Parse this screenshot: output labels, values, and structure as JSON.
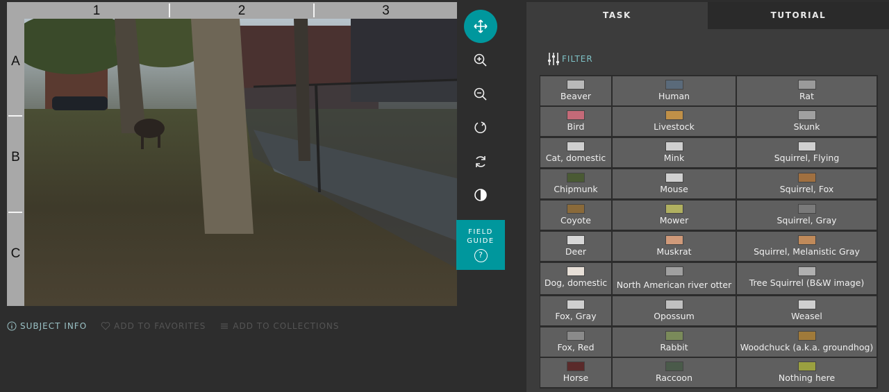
{
  "viewer": {
    "columns": [
      "1",
      "2",
      "3"
    ],
    "rows": [
      "A",
      "B",
      "C"
    ]
  },
  "tools": {
    "field_guide_line1": "FIELD",
    "field_guide_line2": "GUIDE",
    "field_guide_q": "?"
  },
  "meta": {
    "subject_info": "SUBJECT INFO",
    "add_to_favorites": "ADD TO FAVORITES",
    "add_to_collections": "ADD TO COLLECTIONS"
  },
  "panel": {
    "tab_task": "TASK",
    "tab_tutorial": "TUTORIAL",
    "filter": "FILTER",
    "columns": [
      [
        "Beaver",
        "Bird",
        "Cat, domestic",
        "Chipmunk",
        "Coyote",
        "Deer",
        "Dog, domestic",
        "Fox, Gray",
        "Fox, Red",
        "Horse"
      ],
      [
        "Human",
        "Livestock",
        "Mink",
        "Mouse",
        "Mower",
        "Muskrat",
        "North American river otter",
        "Opossum",
        "Rabbit",
        "Raccoon"
      ],
      [
        "Rat",
        "Skunk",
        "Squirrel, Flying",
        "Squirrel, Fox",
        "Squirrel, Gray",
        "Squirrel, Melanistic Gray",
        "Tree Squirrel (B&W image)",
        "Weasel",
        "Woodchuck (a.k.a. groundhog)",
        "Nothing here"
      ]
    ],
    "thumb_colors": [
      [
        "#b9b9b9",
        "#c46a78",
        "#cfcfcf",
        "#4a5a34",
        "#8a6a3a",
        "#d8d8d8",
        "#e8e0d8",
        "#cfcfcf",
        "#8a8a8a",
        "#5a2a2a"
      ],
      [
        "#5a6a7a",
        "#c09048",
        "#cfcfcf",
        "#d0d0d0",
        "#b0b060",
        "#d09a7a",
        "#a0a0a0",
        "#c0c0c0",
        "#7a8a5a",
        "#4a5a4a"
      ],
      [
        "#9a9a9a",
        "#a0a0a0",
        "#d0d0d0",
        "#a07040",
        "#7a7a7a",
        "#c08a5a",
        "#b0b0b0",
        "#cfcfcf",
        "#a07a3a",
        "#9aa040"
      ]
    ]
  }
}
